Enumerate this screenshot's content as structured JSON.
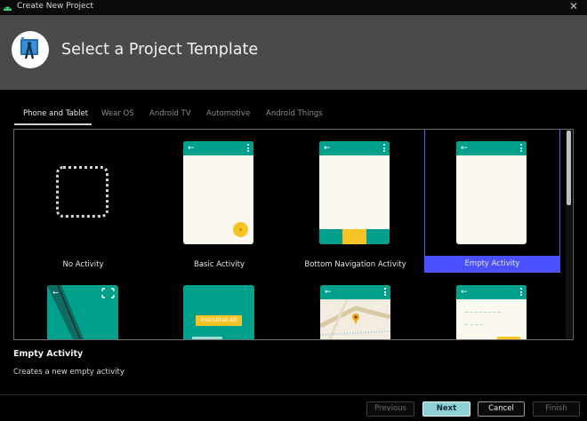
{
  "window": {
    "title": "Create New Project",
    "close_glyph": "✕"
  },
  "header": {
    "title": "Select a Project Template",
    "logo_icon": "android-studio-logo-icon"
  },
  "tabs": [
    {
      "label": "Phone and Tablet",
      "active": true
    },
    {
      "label": "Wear OS",
      "active": false
    },
    {
      "label": "Android TV",
      "active": false
    },
    {
      "label": "Automotive",
      "active": false
    },
    {
      "label": "Android Things",
      "active": false
    }
  ],
  "templates": [
    {
      "label": "No Activity",
      "selected": false
    },
    {
      "label": "Basic Activity",
      "selected": false
    },
    {
      "label": "Bottom Navigation Activity",
      "selected": false
    },
    {
      "label": "Empty Activity",
      "selected": true
    }
  ],
  "partial_templates": {
    "interstitial_ad_label": "Interstitial AD"
  },
  "description": {
    "title": "Empty Activity",
    "text": "Creates a new empty activity"
  },
  "buttons": {
    "previous": "Previous",
    "next": "Next",
    "cancel": "Cancel",
    "finish": "Finish"
  },
  "colors": {
    "accent_teal": "#00a08c",
    "accent_yellow": "#f7c325",
    "selection_blue": "#4a50ff",
    "header_bg": "#4a4a4a"
  }
}
